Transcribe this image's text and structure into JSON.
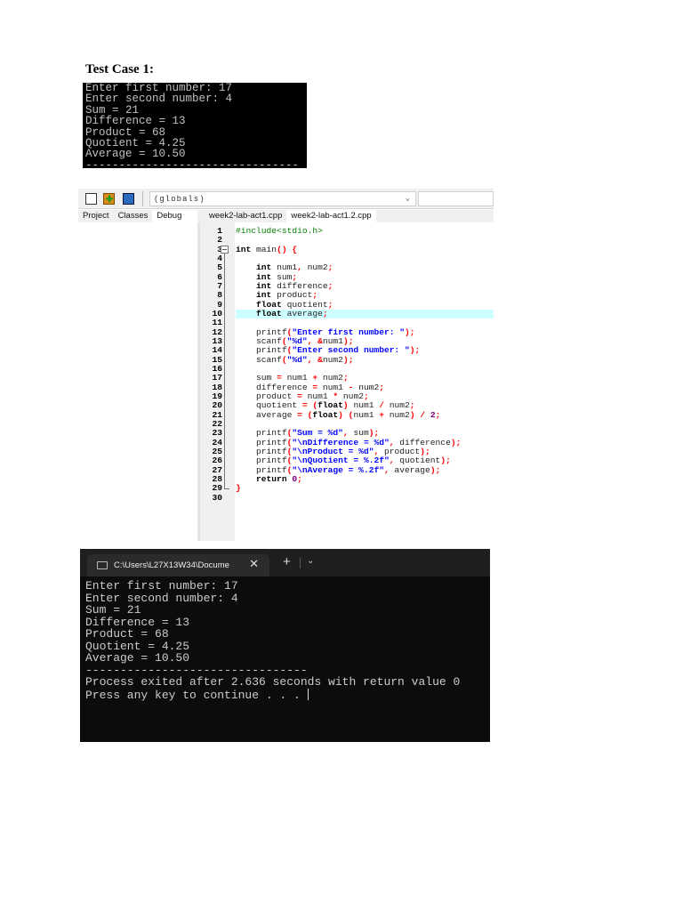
{
  "heading": "Test Case 1:",
  "terminal1": {
    "lines": [
      "Enter first number: 17",
      "Enter second number: 4",
      "Sum = 21",
      "Difference = 13",
      "Product = 68",
      "Quotient = 4.25",
      "Average = 10.50",
      "--------------------------------"
    ]
  },
  "ide": {
    "toolbar": {
      "icons": [
        "window-icon",
        "add-icon",
        "book-icon"
      ],
      "scope_select": "(globals)"
    },
    "left_tabs": [
      "Project",
      "Classes",
      "Debug"
    ],
    "active_left_tab": "Debug",
    "file_tabs": [
      "week2-lab-act1.cpp",
      "week2-lab-act1.2.cpp"
    ],
    "active_file_tab": "week2-lab-act1.2.cpp",
    "highlighted_line": 10,
    "colors": {
      "highlight": "#ccffff",
      "string": "#0000ff",
      "symbol": "#ff0000",
      "preprocessor": "#008000",
      "number": "#800080"
    },
    "code": [
      [
        [
          "#include<stdio.h>",
          "g"
        ]
      ],
      [],
      [
        [
          "int",
          "k"
        ],
        [
          " main",
          "t"
        ],
        [
          "() {",
          "p"
        ]
      ],
      [],
      [
        [
          "    int",
          "k"
        ],
        [
          " num1",
          "t"
        ],
        [
          ",",
          "p"
        ],
        [
          " num2",
          "t"
        ],
        [
          ";",
          "p"
        ]
      ],
      [
        [
          "    int",
          "k"
        ],
        [
          " sum",
          "t"
        ],
        [
          ";",
          "p"
        ]
      ],
      [
        [
          "    int",
          "k"
        ],
        [
          " difference",
          "t"
        ],
        [
          ";",
          "p"
        ]
      ],
      [
        [
          "    int",
          "k"
        ],
        [
          " product",
          "t"
        ],
        [
          ";",
          "p"
        ]
      ],
      [
        [
          "    float",
          "k"
        ],
        [
          " quotient",
          "t"
        ],
        [
          ";",
          "p"
        ]
      ],
      [
        [
          "    float",
          "k"
        ],
        [
          " average",
          "t"
        ],
        [
          ";",
          "p"
        ]
      ],
      [],
      [
        [
          "    printf",
          "t"
        ],
        [
          "(",
          "p"
        ],
        [
          "\"Enter first number: \"",
          "s"
        ],
        [
          ");",
          "p"
        ]
      ],
      [
        [
          "    scanf",
          "t"
        ],
        [
          "(",
          "p"
        ],
        [
          "\"%d\"",
          "s"
        ],
        [
          ", &",
          "p"
        ],
        [
          "num1",
          "t"
        ],
        [
          ");",
          "p"
        ]
      ],
      [
        [
          "    printf",
          "t"
        ],
        [
          "(",
          "p"
        ],
        [
          "\"Enter second number: \"",
          "s"
        ],
        [
          ");",
          "p"
        ]
      ],
      [
        [
          "    scanf",
          "t"
        ],
        [
          "(",
          "p"
        ],
        [
          "\"%d\"",
          "s"
        ],
        [
          ", &",
          "p"
        ],
        [
          "num2",
          "t"
        ],
        [
          ");",
          "p"
        ]
      ],
      [],
      [
        [
          "    sum ",
          "t"
        ],
        [
          "=",
          "p"
        ],
        [
          " num1 ",
          "t"
        ],
        [
          "+",
          "p"
        ],
        [
          " num2",
          "t"
        ],
        [
          ";",
          "p"
        ]
      ],
      [
        [
          "    difference ",
          "t"
        ],
        [
          "=",
          "p"
        ],
        [
          " num1 ",
          "t"
        ],
        [
          "-",
          "p"
        ],
        [
          " num2",
          "t"
        ],
        [
          ";",
          "p"
        ]
      ],
      [
        [
          "    product ",
          "t"
        ],
        [
          "=",
          "p"
        ],
        [
          " num1 ",
          "t"
        ],
        [
          "*",
          "p"
        ],
        [
          " num2",
          "t"
        ],
        [
          ";",
          "p"
        ]
      ],
      [
        [
          "    quotient ",
          "t"
        ],
        [
          "= (",
          "p"
        ],
        [
          "float",
          "k"
        ],
        [
          ")",
          "p"
        ],
        [
          " num1 ",
          "t"
        ],
        [
          "/",
          "p"
        ],
        [
          " num2",
          "t"
        ],
        [
          ";",
          "p"
        ]
      ],
      [
        [
          "    average ",
          "t"
        ],
        [
          "= (",
          "p"
        ],
        [
          "float",
          "k"
        ],
        [
          ") (",
          "p"
        ],
        [
          "num1 ",
          "t"
        ],
        [
          "+",
          "p"
        ],
        [
          " num2",
          "t"
        ],
        [
          ") / ",
          "p"
        ],
        [
          "2",
          "n"
        ],
        [
          ";",
          "p"
        ]
      ],
      [],
      [
        [
          "    printf",
          "t"
        ],
        [
          "(",
          "p"
        ],
        [
          "\"Sum = %d\"",
          "s"
        ],
        [
          ", ",
          "p"
        ],
        [
          "sum",
          "t"
        ],
        [
          ");",
          "p"
        ]
      ],
      [
        [
          "    printf",
          "t"
        ],
        [
          "(",
          "p"
        ],
        [
          "\"\\nDifference = %d\"",
          "s"
        ],
        [
          ", ",
          "p"
        ],
        [
          "difference",
          "t"
        ],
        [
          ");",
          "p"
        ]
      ],
      [
        [
          "    printf",
          "t"
        ],
        [
          "(",
          "p"
        ],
        [
          "\"\\nProduct = %d\"",
          "s"
        ],
        [
          ", ",
          "p"
        ],
        [
          "product",
          "t"
        ],
        [
          ");",
          "p"
        ]
      ],
      [
        [
          "    printf",
          "t"
        ],
        [
          "(",
          "p"
        ],
        [
          "\"\\nQuotient = %.2f\"",
          "s"
        ],
        [
          ", ",
          "p"
        ],
        [
          "quotient",
          "t"
        ],
        [
          ");",
          "p"
        ]
      ],
      [
        [
          "    printf",
          "t"
        ],
        [
          "(",
          "p"
        ],
        [
          "\"\\nAverage = %.2f\"",
          "s"
        ],
        [
          ", ",
          "p"
        ],
        [
          "average",
          "t"
        ],
        [
          ");",
          "p"
        ]
      ],
      [
        [
          "    return",
          "k"
        ],
        [
          " 0",
          "n"
        ],
        [
          ";",
          "p"
        ]
      ],
      [
        [
          "}",
          "p"
        ]
      ],
      []
    ]
  },
  "terminal2": {
    "tab_title": "C:\\Users\\L27X13W34\\Docume",
    "close": "✕",
    "new_tab": "+",
    "menu": "⌄",
    "lines": [
      "Enter first number: 17",
      "Enter second number: 4",
      "Sum = 21",
      "Difference = 13",
      "Product = 68",
      "Quotient = 4.25",
      "Average = 10.50",
      "--------------------------------",
      "Process exited after 2.636 seconds with return value 0",
      "Press any key to continue . . . "
    ]
  }
}
